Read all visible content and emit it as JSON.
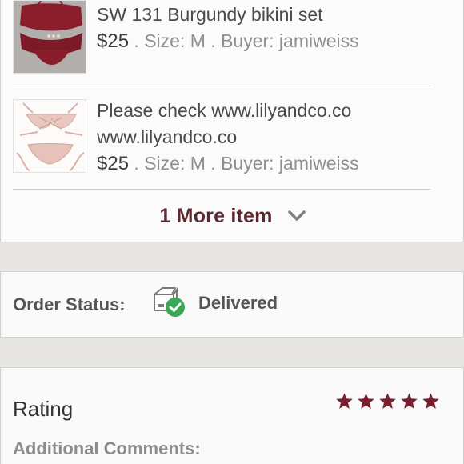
{
  "items": [
    {
      "title_lines": [
        "SW 131 Burgundy bikini set"
      ],
      "price": "$25",
      "details": " . Size: M . Buyer: jamiweiss"
    },
    {
      "title_lines": [
        "Please check www.lilyandco.co",
        "www.lilyandco.co"
      ],
      "price": "$25",
      "details": " . Size: M . Buyer: jamiweiss"
    }
  ],
  "more_items": {
    "label": "1 More item",
    "icon": "chevron-down-icon"
  },
  "order_status": {
    "label": "Order Status:",
    "value": "Delivered",
    "icon": "package-delivered-icon"
  },
  "rating": {
    "label": "Rating",
    "stars": 5,
    "max_stars": 5
  },
  "comments": {
    "label": "Additional Comments:"
  },
  "colors": {
    "accent": "#7a1f2e",
    "check": "#3aa757",
    "band": "#e8e6e2"
  }
}
